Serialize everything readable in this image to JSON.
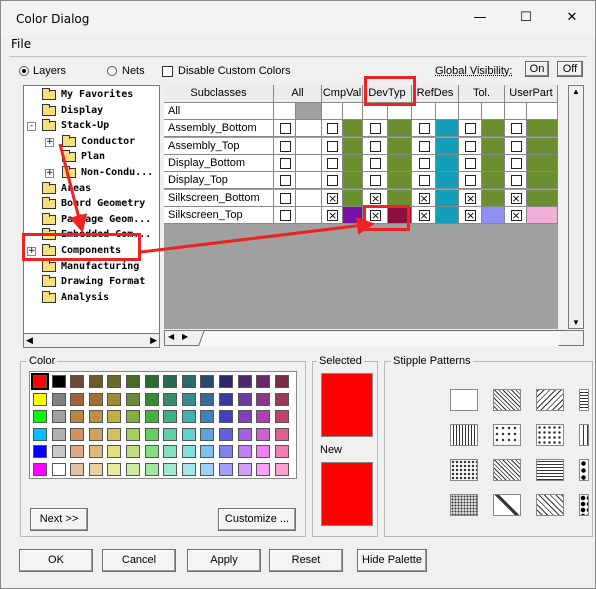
{
  "window": {
    "title": "Color Dialog",
    "minimize": "—",
    "maximize": "☐",
    "close": "✕"
  },
  "menu": {
    "file": "File"
  },
  "mode": {
    "layers": "Layers",
    "nets": "Nets",
    "disable_custom": "Disable Custom Colors",
    "global_visibility": "Global Visibility:",
    "on": "On",
    "off": "Off"
  },
  "tree": {
    "items": [
      "My Favorites",
      "Display",
      "Stack-Up",
      "Conductor",
      "Plan",
      "Non-Condu...",
      "Areas",
      "Board Geometry",
      "Package Geom...",
      "Embedded Com...",
      "Components",
      "Manufacturing",
      "Drawing Format",
      "Analysis"
    ]
  },
  "grid": {
    "headers": [
      "Subclasses",
      "All",
      "CmpVal",
      "DevTyp",
      "RefDes",
      "Tol.",
      "UserPart"
    ],
    "rows": [
      "All",
      "Assembly_Bottom",
      "Assembly_Top",
      "Display_Bottom",
      "Display_Top",
      "Silkscreen_Bottom",
      "Silkscreen_Top"
    ],
    "checked_rows": [
      "Silkscreen_Bottom",
      "Silkscreen_Top"
    ],
    "colors": {
      "green": "#6b8e2f",
      "teal": "#149fb8",
      "purple": "#7a10a8",
      "maroon": "#8a1040",
      "lavender": "#8f8ff2",
      "pink": "#f2b0d8"
    }
  },
  "color_group": {
    "title": "Color",
    "next": "Next >>",
    "customize": "Customize ..."
  },
  "selected": {
    "title": "Selected",
    "new_label": "New",
    "color": "#ff0000"
  },
  "stipple": {
    "title": "Stipple Patterns"
  },
  "buttons": {
    "ok": "OK",
    "cancel": "Cancel",
    "apply": "Apply",
    "reset": "Reset",
    "hide_palette": "Hide Palette"
  },
  "annotation": {
    "color": "#e22222"
  }
}
